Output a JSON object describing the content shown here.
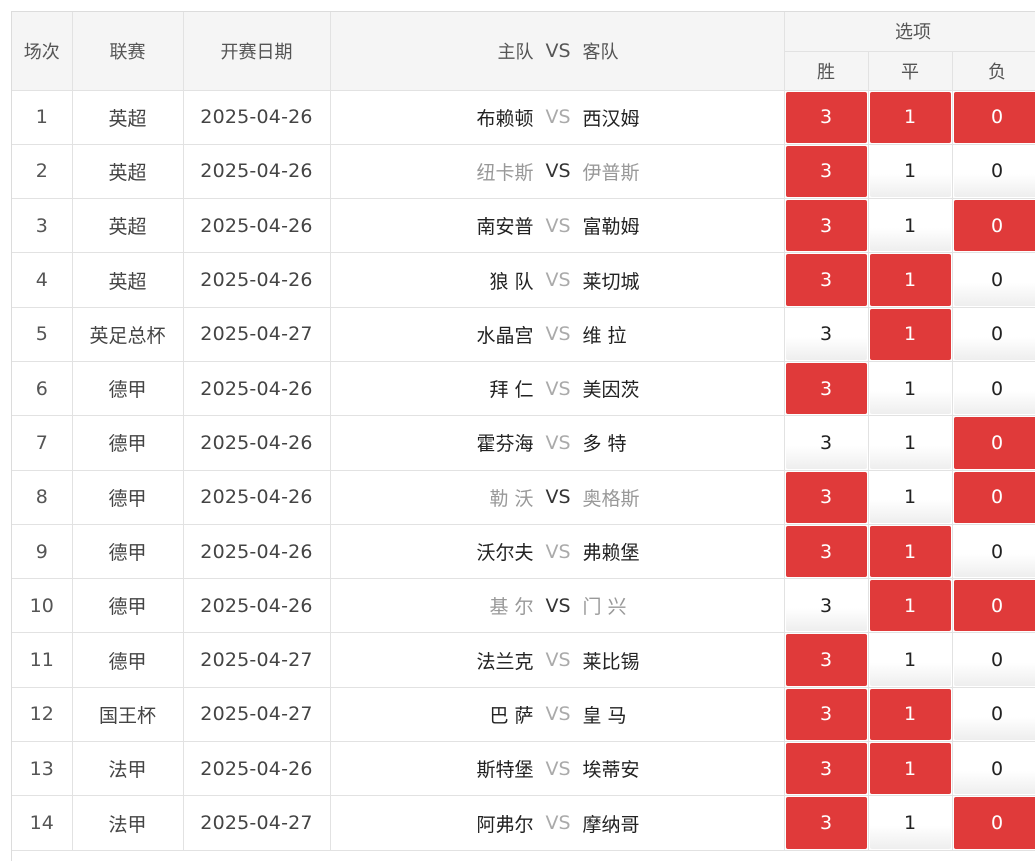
{
  "header": {
    "index": "场次",
    "league": "联赛",
    "date": "开赛日期",
    "home": "主队",
    "vs": "VS",
    "away": "客队",
    "options": "选项",
    "win": "胜",
    "draw": "平",
    "lose": "负"
  },
  "colors": {
    "selected": "#e03a3a",
    "unselected": "#ffffff",
    "header_bg": "#f5f5f5"
  },
  "rows": [
    {
      "index": "1",
      "league": "英超",
      "date": "2025-04-26",
      "home": "布赖顿",
      "vs": "VS",
      "away": "西汉姆",
      "muted": false,
      "win": "3",
      "draw": "1",
      "lose": "0",
      "sel": [
        true,
        true,
        true
      ]
    },
    {
      "index": "2",
      "league": "英超",
      "date": "2025-04-26",
      "home": "纽卡斯",
      "vs": "VS",
      "away": "伊普斯",
      "muted": true,
      "win": "3",
      "draw": "1",
      "lose": "0",
      "sel": [
        true,
        false,
        false
      ]
    },
    {
      "index": "3",
      "league": "英超",
      "date": "2025-04-26",
      "home": "南安普",
      "vs": "VS",
      "away": "富勒姆",
      "muted": false,
      "win": "3",
      "draw": "1",
      "lose": "0",
      "sel": [
        true,
        false,
        true
      ]
    },
    {
      "index": "4",
      "league": "英超",
      "date": "2025-04-26",
      "home": "狼 队",
      "vs": "VS",
      "away": "莱切城",
      "muted": false,
      "win": "3",
      "draw": "1",
      "lose": "0",
      "sel": [
        true,
        true,
        false
      ]
    },
    {
      "index": "5",
      "league": "英足总杯",
      "date": "2025-04-27",
      "home": "水晶宫",
      "vs": "VS",
      "away": "维 拉",
      "muted": false,
      "win": "3",
      "draw": "1",
      "lose": "0",
      "sel": [
        false,
        true,
        false
      ]
    },
    {
      "index": "6",
      "league": "德甲",
      "date": "2025-04-26",
      "home": "拜 仁",
      "vs": "VS",
      "away": "美因茨",
      "muted": false,
      "win": "3",
      "draw": "1",
      "lose": "0",
      "sel": [
        true,
        false,
        false
      ]
    },
    {
      "index": "7",
      "league": "德甲",
      "date": "2025-04-26",
      "home": "霍芬海",
      "vs": "VS",
      "away": "多 特",
      "muted": false,
      "win": "3",
      "draw": "1",
      "lose": "0",
      "sel": [
        false,
        false,
        true
      ]
    },
    {
      "index": "8",
      "league": "德甲",
      "date": "2025-04-26",
      "home": "勒 沃",
      "vs": "VS",
      "away": "奥格斯",
      "muted": true,
      "win": "3",
      "draw": "1",
      "lose": "0",
      "sel": [
        true,
        false,
        true
      ]
    },
    {
      "index": "9",
      "league": "德甲",
      "date": "2025-04-26",
      "home": "沃尔夫",
      "vs": "VS",
      "away": "弗赖堡",
      "muted": false,
      "win": "3",
      "draw": "1",
      "lose": "0",
      "sel": [
        true,
        true,
        false
      ]
    },
    {
      "index": "10",
      "league": "德甲",
      "date": "2025-04-26",
      "home": "基 尔",
      "vs": "VS",
      "away": "门 兴",
      "muted": true,
      "win": "3",
      "draw": "1",
      "lose": "0",
      "sel": [
        false,
        true,
        true
      ]
    },
    {
      "index": "11",
      "league": "德甲",
      "date": "2025-04-27",
      "home": "法兰克",
      "vs": "VS",
      "away": "莱比锡",
      "muted": false,
      "win": "3",
      "draw": "1",
      "lose": "0",
      "sel": [
        true,
        false,
        false
      ]
    },
    {
      "index": "12",
      "league": "国王杯",
      "date": "2025-04-27",
      "home": "巴 萨",
      "vs": "VS",
      "away": "皇 马",
      "muted": false,
      "win": "3",
      "draw": "1",
      "lose": "0",
      "sel": [
        true,
        true,
        false
      ]
    },
    {
      "index": "13",
      "league": "法甲",
      "date": "2025-04-26",
      "home": "斯特堡",
      "vs": "VS",
      "away": "埃蒂安",
      "muted": false,
      "win": "3",
      "draw": "1",
      "lose": "0",
      "sel": [
        true,
        true,
        false
      ]
    },
    {
      "index": "14",
      "league": "法甲",
      "date": "2025-04-27",
      "home": "阿弗尔",
      "vs": "VS",
      "away": "摩纳哥",
      "muted": false,
      "win": "3",
      "draw": "1",
      "lose": "0",
      "sel": [
        true,
        false,
        true
      ]
    }
  ]
}
